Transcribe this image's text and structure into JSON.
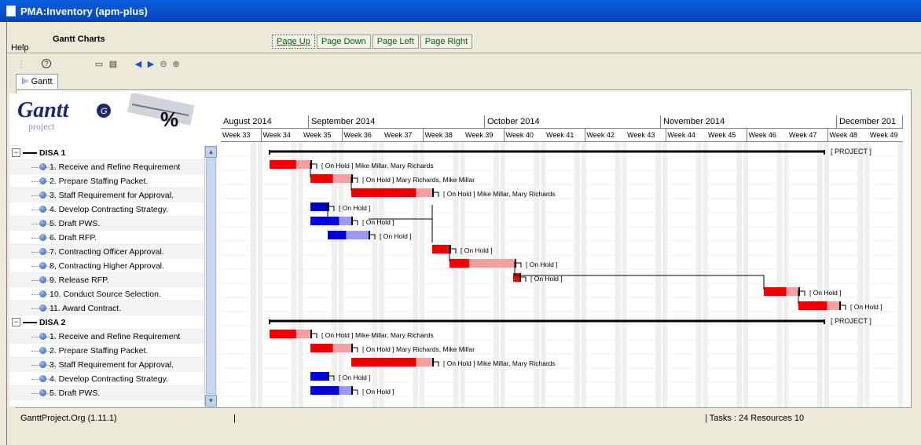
{
  "window": {
    "title": "PMA:Inventory (apm-plus)"
  },
  "header": {
    "title": "Gantt Charts"
  },
  "pager": {
    "page_up": "Page Up",
    "page_down": "Page Down",
    "page_left": "Page Left",
    "page_right": "Page Right"
  },
  "menu": {
    "help": "Help"
  },
  "tabs": {
    "gantt": "Gantt"
  },
  "logo": {
    "word": "Gantt",
    "sub": "project",
    "percent": "%"
  },
  "timeline": {
    "months": [
      "August 2014",
      "September 2014",
      "October 2014",
      "November 2014",
      "December 201"
    ],
    "weeks": [
      "Week 33",
      "Week 34",
      "Week 35",
      "Week 36",
      "Week 37",
      "Week 38",
      "Week 39",
      "Week 40",
      "Week 41",
      "Week 42",
      "Week 43",
      "Week 44",
      "Week 45",
      "Week 46",
      "Week 47",
      "Week 48",
      "Week 49"
    ]
  },
  "tree": [
    {
      "type": "group",
      "label": "DISA 1"
    },
    {
      "type": "task",
      "label": "1. Receive and Refine Requirement"
    },
    {
      "type": "task",
      "label": "2. Prepare Staffing Packet."
    },
    {
      "type": "task",
      "label": "3. Staff Requirement for Approval."
    },
    {
      "type": "task",
      "label": "4. Develop Contracting Strategy."
    },
    {
      "type": "task",
      "label": "5. Draft PWS."
    },
    {
      "type": "task",
      "label": "6. Draft RFP."
    },
    {
      "type": "task",
      "label": "7. Contracting Officer Approval."
    },
    {
      "type": "task",
      "label": "8, Contracting Higher Approval."
    },
    {
      "type": "task",
      "label": "9. Release RFP."
    },
    {
      "type": "task",
      "label": "10. Conduct Source Selection."
    },
    {
      "type": "task",
      "label": "11. Award Contract."
    },
    {
      "type": "group",
      "label": "DISA 2"
    },
    {
      "type": "task",
      "label": "1. Receive and Refine Requirement"
    },
    {
      "type": "task",
      "label": "2. Prepare Staffing Packet."
    },
    {
      "type": "task",
      "label": "3. Staff Requirement for Approval."
    },
    {
      "type": "task",
      "label": "4. Develop Contracting Strategy."
    },
    {
      "type": "task",
      "label": "5. Draft PWS."
    }
  ],
  "bars": [
    {
      "row": 0,
      "kind": "summary",
      "label": "[ PROJECT ]"
    },
    {
      "row": 1,
      "kind": "task",
      "color": "red",
      "label": "[ On Hold ] Mike Millar, Mary Richards"
    },
    {
      "row": 2,
      "kind": "task",
      "color": "red",
      "label": "[ On Hold ] Mary Richards, Mike Millar"
    },
    {
      "row": 3,
      "kind": "task",
      "color": "red",
      "label": "[ On Hold ] Mike Millar, Mary Richards"
    },
    {
      "row": 4,
      "kind": "task",
      "color": "blue",
      "label": "[ On Hold ]"
    },
    {
      "row": 5,
      "kind": "task",
      "color": "blue",
      "label": "[ On Hold ]"
    },
    {
      "row": 6,
      "kind": "task",
      "color": "blue",
      "label": "[ On Hold ]"
    },
    {
      "row": 7,
      "kind": "task",
      "color": "red",
      "label": "[ On Hold ]"
    },
    {
      "row": 8,
      "kind": "task",
      "color": "red",
      "label": "[ On Hold ]"
    },
    {
      "row": 9,
      "kind": "task",
      "color": "red",
      "label": "[ On Hold ]"
    },
    {
      "row": 10,
      "kind": "task",
      "color": "red",
      "label": "[ On Hold ]"
    },
    {
      "row": 11,
      "kind": "task",
      "color": "red",
      "label": "[ On Hold ]"
    },
    {
      "row": 12,
      "kind": "summary",
      "label": "[ PROJECT ]"
    },
    {
      "row": 13,
      "kind": "task",
      "color": "red",
      "label": "[ On Hold ] Mike Millar, Mary Richards"
    },
    {
      "row": 14,
      "kind": "task",
      "color": "red",
      "label": "[ On Hold ] Mary Richards, Mike Millar"
    },
    {
      "row": 15,
      "kind": "task",
      "color": "red",
      "label": "[ On Hold ] Mike Millar, Mary Richards"
    },
    {
      "row": 16,
      "kind": "task",
      "color": "blue",
      "label": "[ On Hold ]"
    },
    {
      "row": 17,
      "kind": "task",
      "color": "blue",
      "label": "[ On Hold ]"
    }
  ],
  "status": {
    "version": "GanttProject.Org (1.11.1)",
    "separator": "|",
    "counts": "| Tasks : 24  Resources 10"
  },
  "colors": {
    "titlebar": "#0a5fdf",
    "task_red": "#ee0000",
    "task_red_light": "#f2a0a0",
    "task_blue": "#0000dd",
    "task_blue_light": "#9a9af0",
    "link_green": "#006400"
  }
}
